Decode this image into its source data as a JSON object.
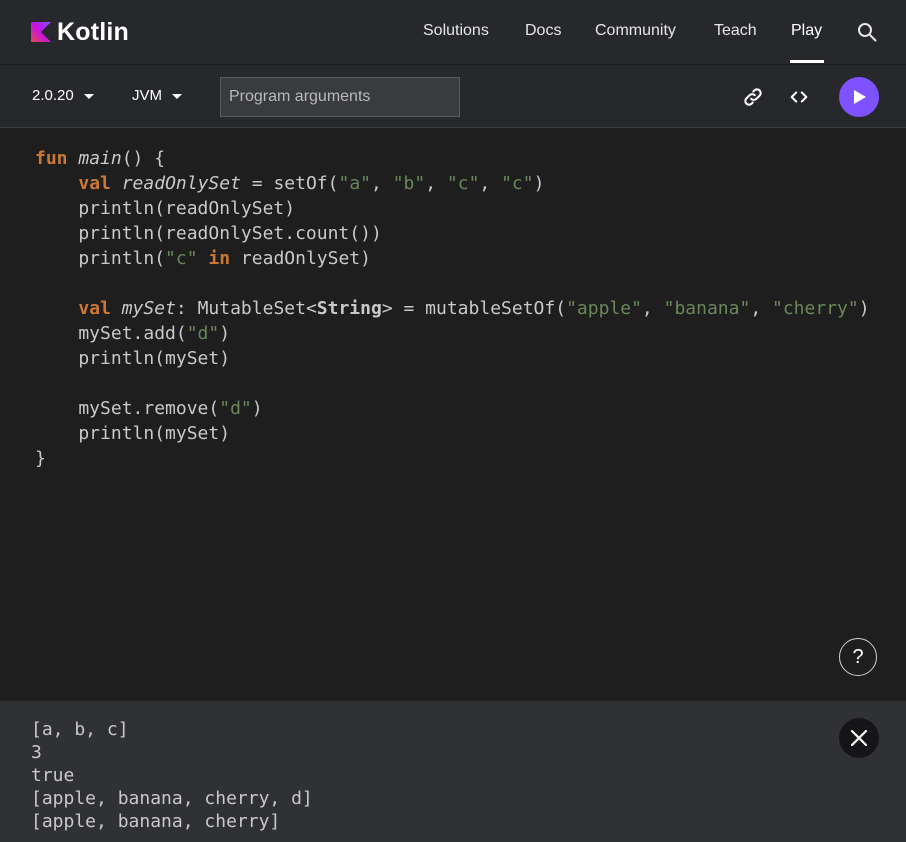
{
  "brand": {
    "name": "Kotlin"
  },
  "nav": {
    "items": [
      {
        "label": "Solutions"
      },
      {
        "label": "Docs"
      },
      {
        "label": "Community"
      },
      {
        "label": "Teach"
      },
      {
        "label": "Play"
      }
    ],
    "active": "Play"
  },
  "toolbar": {
    "version": "2.0.20",
    "target": "JVM",
    "args_placeholder": "Program arguments"
  },
  "colors": {
    "accent": "#7f52ff",
    "keyword": "#cc7832",
    "string": "#6a8759"
  },
  "code": {
    "tokens": [
      "fun",
      " ",
      "main",
      "() {",
      "    ",
      "val",
      " ",
      "readOnlySet",
      " = setOf(",
      "\"a\"",
      ", ",
      "\"b\"",
      ", ",
      "\"c\"",
      ", ",
      "\"c\"",
      ")",
      "    println(readOnlySet)",
      "    println(readOnlySet.count())",
      "    println(",
      "\"c\"",
      " ",
      "in",
      " readOnlySet)",
      "    ",
      "val",
      " ",
      "mySet",
      ": MutableSet<",
      "String",
      "> = mutableSetOf(",
      "\"apple\"",
      ", ",
      "\"banana\"",
      ", ",
      "\"cherry\"",
      ")",
      "    mySet.add(",
      "\"d\"",
      ")",
      "    println(mySet)",
      "    mySet.remove(",
      "\"d\"",
      ")",
      "    println(mySet)",
      "}"
    ]
  },
  "output": {
    "lines": [
      "[a, b, c]",
      "3",
      "true",
      "[apple, banana, cherry, d]",
      "[apple, banana, cherry]"
    ]
  },
  "icons": {
    "search": "search-icon",
    "link": "link-icon",
    "embed": "code-embed-icon",
    "run": "play-icon",
    "help": "question-icon",
    "close": "close-icon"
  },
  "help_label": "?"
}
